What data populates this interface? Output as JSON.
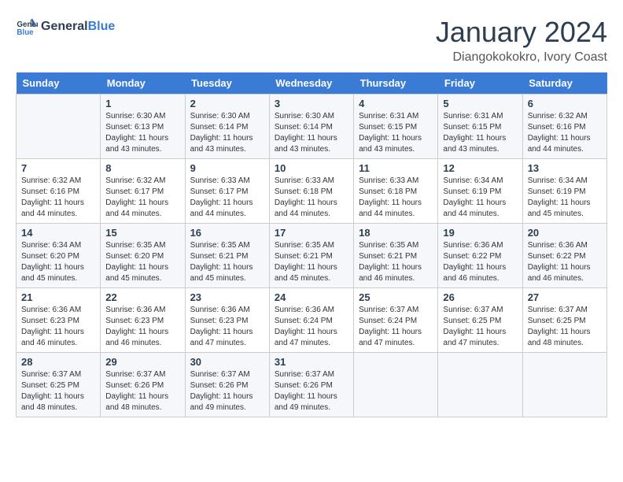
{
  "header": {
    "logo_line1": "General",
    "logo_line2": "Blue",
    "month": "January 2024",
    "location": "Diangokokokro, Ivory Coast"
  },
  "weekdays": [
    "Sunday",
    "Monday",
    "Tuesday",
    "Wednesday",
    "Thursday",
    "Friday",
    "Saturday"
  ],
  "weeks": [
    [
      {
        "day": "",
        "info": ""
      },
      {
        "day": "1",
        "info": "Sunrise: 6:30 AM\nSunset: 6:13 PM\nDaylight: 11 hours\nand 43 minutes."
      },
      {
        "day": "2",
        "info": "Sunrise: 6:30 AM\nSunset: 6:14 PM\nDaylight: 11 hours\nand 43 minutes."
      },
      {
        "day": "3",
        "info": "Sunrise: 6:30 AM\nSunset: 6:14 PM\nDaylight: 11 hours\nand 43 minutes."
      },
      {
        "day": "4",
        "info": "Sunrise: 6:31 AM\nSunset: 6:15 PM\nDaylight: 11 hours\nand 43 minutes."
      },
      {
        "day": "5",
        "info": "Sunrise: 6:31 AM\nSunset: 6:15 PM\nDaylight: 11 hours\nand 43 minutes."
      },
      {
        "day": "6",
        "info": "Sunrise: 6:32 AM\nSunset: 6:16 PM\nDaylight: 11 hours\nand 44 minutes."
      }
    ],
    [
      {
        "day": "7",
        "info": "Sunrise: 6:32 AM\nSunset: 6:16 PM\nDaylight: 11 hours\nand 44 minutes."
      },
      {
        "day": "8",
        "info": "Sunrise: 6:32 AM\nSunset: 6:17 PM\nDaylight: 11 hours\nand 44 minutes."
      },
      {
        "day": "9",
        "info": "Sunrise: 6:33 AM\nSunset: 6:17 PM\nDaylight: 11 hours\nand 44 minutes."
      },
      {
        "day": "10",
        "info": "Sunrise: 6:33 AM\nSunset: 6:18 PM\nDaylight: 11 hours\nand 44 minutes."
      },
      {
        "day": "11",
        "info": "Sunrise: 6:33 AM\nSunset: 6:18 PM\nDaylight: 11 hours\nand 44 minutes."
      },
      {
        "day": "12",
        "info": "Sunrise: 6:34 AM\nSunset: 6:19 PM\nDaylight: 11 hours\nand 44 minutes."
      },
      {
        "day": "13",
        "info": "Sunrise: 6:34 AM\nSunset: 6:19 PM\nDaylight: 11 hours\nand 45 minutes."
      }
    ],
    [
      {
        "day": "14",
        "info": "Sunrise: 6:34 AM\nSunset: 6:20 PM\nDaylight: 11 hours\nand 45 minutes."
      },
      {
        "day": "15",
        "info": "Sunrise: 6:35 AM\nSunset: 6:20 PM\nDaylight: 11 hours\nand 45 minutes."
      },
      {
        "day": "16",
        "info": "Sunrise: 6:35 AM\nSunset: 6:21 PM\nDaylight: 11 hours\nand 45 minutes."
      },
      {
        "day": "17",
        "info": "Sunrise: 6:35 AM\nSunset: 6:21 PM\nDaylight: 11 hours\nand 45 minutes."
      },
      {
        "day": "18",
        "info": "Sunrise: 6:35 AM\nSunset: 6:21 PM\nDaylight: 11 hours\nand 46 minutes."
      },
      {
        "day": "19",
        "info": "Sunrise: 6:36 AM\nSunset: 6:22 PM\nDaylight: 11 hours\nand 46 minutes."
      },
      {
        "day": "20",
        "info": "Sunrise: 6:36 AM\nSunset: 6:22 PM\nDaylight: 11 hours\nand 46 minutes."
      }
    ],
    [
      {
        "day": "21",
        "info": "Sunrise: 6:36 AM\nSunset: 6:23 PM\nDaylight: 11 hours\nand 46 minutes."
      },
      {
        "day": "22",
        "info": "Sunrise: 6:36 AM\nSunset: 6:23 PM\nDaylight: 11 hours\nand 46 minutes."
      },
      {
        "day": "23",
        "info": "Sunrise: 6:36 AM\nSunset: 6:23 PM\nDaylight: 11 hours\nand 47 minutes."
      },
      {
        "day": "24",
        "info": "Sunrise: 6:36 AM\nSunset: 6:24 PM\nDaylight: 11 hours\nand 47 minutes."
      },
      {
        "day": "25",
        "info": "Sunrise: 6:37 AM\nSunset: 6:24 PM\nDaylight: 11 hours\nand 47 minutes."
      },
      {
        "day": "26",
        "info": "Sunrise: 6:37 AM\nSunset: 6:25 PM\nDaylight: 11 hours\nand 47 minutes."
      },
      {
        "day": "27",
        "info": "Sunrise: 6:37 AM\nSunset: 6:25 PM\nDaylight: 11 hours\nand 48 minutes."
      }
    ],
    [
      {
        "day": "28",
        "info": "Sunrise: 6:37 AM\nSunset: 6:25 PM\nDaylight: 11 hours\nand 48 minutes."
      },
      {
        "day": "29",
        "info": "Sunrise: 6:37 AM\nSunset: 6:26 PM\nDaylight: 11 hours\nand 48 minutes."
      },
      {
        "day": "30",
        "info": "Sunrise: 6:37 AM\nSunset: 6:26 PM\nDaylight: 11 hours\nand 49 minutes."
      },
      {
        "day": "31",
        "info": "Sunrise: 6:37 AM\nSunset: 6:26 PM\nDaylight: 11 hours\nand 49 minutes."
      },
      {
        "day": "",
        "info": ""
      },
      {
        "day": "",
        "info": ""
      },
      {
        "day": "",
        "info": ""
      }
    ]
  ]
}
